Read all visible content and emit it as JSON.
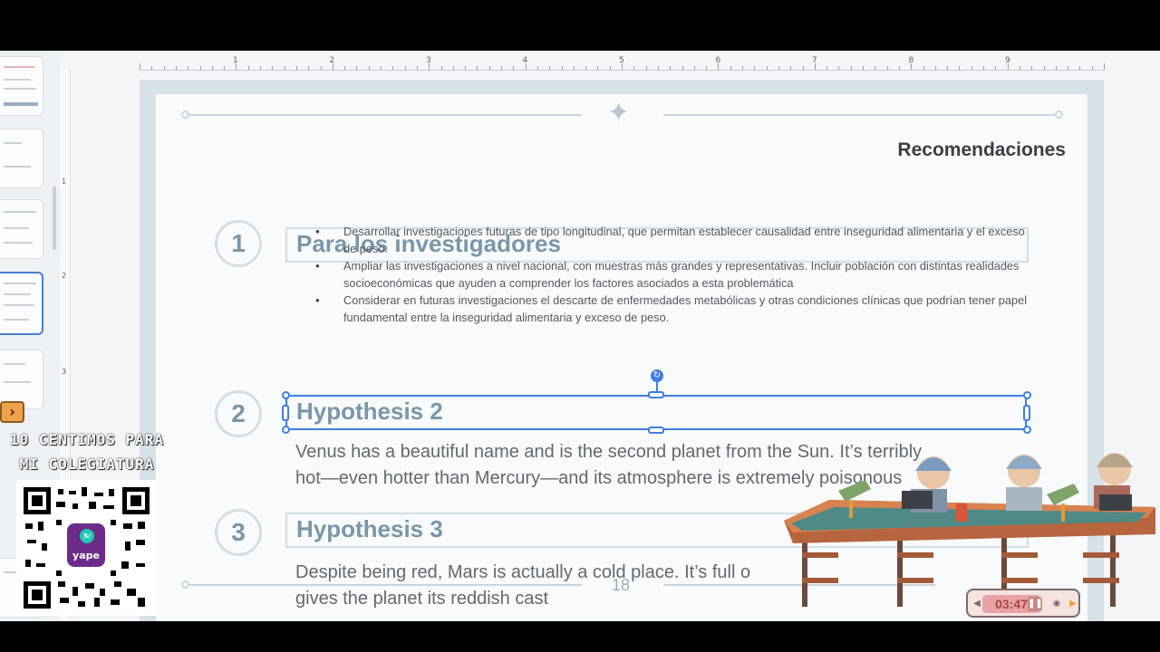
{
  "slide": {
    "title": "Recomendaciones",
    "page_number": "18",
    "sections": [
      {
        "number": "1",
        "heading": "Para los investigadores"
      },
      {
        "number": "2",
        "heading": "Hypothesis 2"
      },
      {
        "number": "3",
        "heading": "Hypothesis 3"
      }
    ],
    "bullets": [
      "Desarrollar investigaciones futuras de tipo longitudinal, que permitan establecer causalidad entre inseguridad alimentaria y el exceso de peso.",
      "Ampliar las investigaciones a nivel nacional, con muestras más grandes y representativas. Incluir población con distintas realidades socioeconómicas que ayuden a comprender los factores asociados a esta problemática",
      "Considerar en futuras investigaciones el descarte de enfermedades metabólicas y otras condiciones clínicas que podrían tener papel fundamental entre la inseguridad alimentaria y exceso de peso."
    ],
    "text_2_line1": "Venus has a beautiful name and is the second planet from the Sun. It’s terribly",
    "text_2_line2": "hot—even hotter than Mercury—and its atmosphere is extremely poisonous",
    "text_3_line1": "Despite being red, Mars is actually a cold place. It’s full o",
    "text_3_line2": "gives the planet its reddish cast"
  },
  "ruler": {
    "marks": [
      "1",
      "2",
      "3",
      "4",
      "5",
      "6",
      "7",
      "8",
      "9"
    ]
  },
  "vruler": {
    "marks": [
      "1",
      "2",
      "3"
    ]
  },
  "overlay": {
    "promo_line1": "10 CENTIMOS PARA",
    "promo_line2": "MI COLEGIATURA",
    "qr_brand": "yape",
    "timer": "03:47"
  },
  "colors": {
    "accent": "#3f7de0",
    "heading": "#7a97a8",
    "frame": "#d6e1e8"
  },
  "icons": {
    "nav": "chevron-right-icon",
    "rotate": "rotate-icon",
    "star": "sparkle-star-icon"
  }
}
